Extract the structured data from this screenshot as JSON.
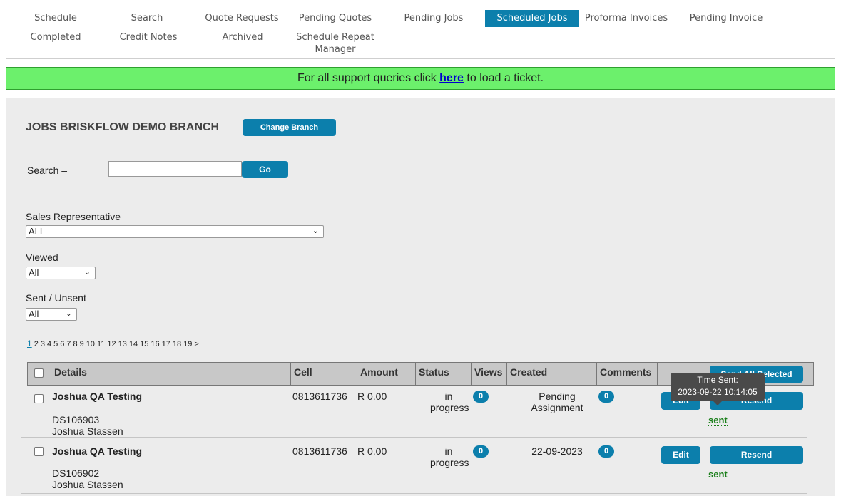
{
  "nav": {
    "schedule": "Schedule",
    "search": "Search",
    "quote_requests": "Quote Requests",
    "pending_quotes": "Pending Quotes",
    "pending_jobs": "Pending Jobs",
    "scheduled_jobs": "Scheduled Jobs",
    "proforma_invoices": "Proforma Invoices",
    "pending_invoice": "Pending Invoice",
    "completed": "Completed",
    "credit_notes": "Credit Notes",
    "archived": "Archived",
    "schedule_repeat_manager_line1": "Schedule Repeat",
    "schedule_repeat_manager_line2": "Manager"
  },
  "banner": {
    "before": "For all support queries click ",
    "link": "here",
    "after": " to load a ticket."
  },
  "page": {
    "title": "JOBS BRISKFLOW DEMO BRANCH",
    "change_branch": "Change Branch"
  },
  "search": {
    "label": "Search –",
    "value": "",
    "placeholder": "",
    "go": "Go"
  },
  "filters": {
    "sales_rep_label": "Sales Representative",
    "sales_rep_value": "ALL",
    "viewed_label": "Viewed",
    "viewed_value": "All",
    "sent_label": "Sent / Unsent",
    "sent_value": "All"
  },
  "pagination": {
    "current": "1",
    "pages": [
      "2",
      "3",
      "4",
      "5",
      "6",
      "7",
      "8",
      "9",
      "10",
      "11",
      "12",
      "13",
      "14",
      "15",
      "16",
      "17",
      "18",
      "19"
    ],
    "next": ">"
  },
  "table": {
    "headers": {
      "details": "Details",
      "cell": "Cell",
      "amount": "Amount",
      "status": "Status",
      "views": "Views",
      "created": "Created",
      "comments": "Comments",
      "send_all": "Send All Selected"
    },
    "rows": [
      {
        "name": "Joshua QA Testing",
        "ref": "DS106903",
        "contact": "Joshua Stassen",
        "cell": "0813611736",
        "amount": "R 0.00",
        "status_line1": "in",
        "status_line2": "progress",
        "views": "0",
        "created_line1": "Pending",
        "created_line2": "Assignment",
        "comments": "0",
        "edit": "Edit",
        "resend": "Resend",
        "sent": "sent"
      },
      {
        "name": "Joshua QA Testing",
        "ref": "DS106902",
        "contact": "Joshua Stassen",
        "cell": "0813611736",
        "amount": "R 0.00",
        "status_line1": "in",
        "status_line2": "progress",
        "views": "0",
        "created_line1": "22-09-2023",
        "created_line2": "",
        "comments": "0",
        "edit": "Edit",
        "resend": "Resend",
        "sent": "sent"
      }
    ]
  },
  "tooltip": {
    "line1": "Time Sent:",
    "line2": "2023-09-22 10:14:05"
  },
  "colors": {
    "accent": "#0c7fac",
    "banner": "#6cf06c",
    "sent": "#1a7f1a"
  }
}
